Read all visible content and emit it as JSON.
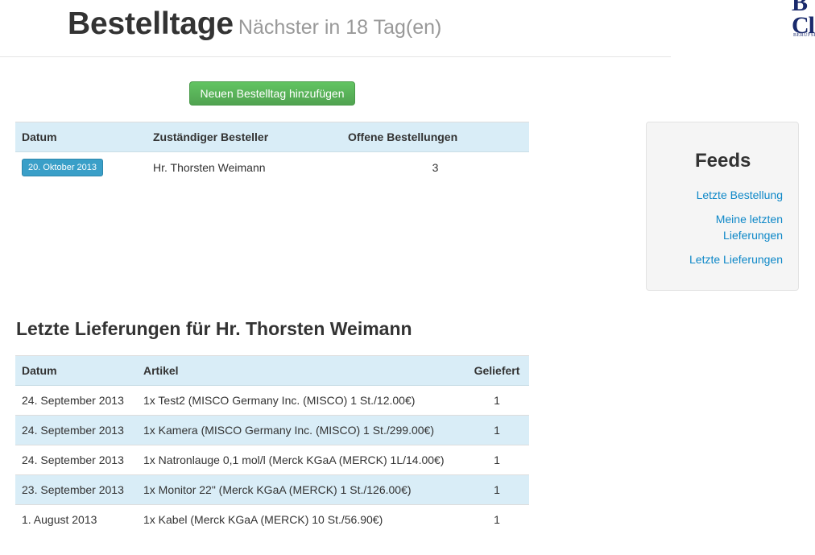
{
  "header": {
    "title": "Bestelltage",
    "subtitle": "Nächster in 18 Tag(en)"
  },
  "logo": {
    "big_text": "B\nCl",
    "small_text": "Berufsf"
  },
  "actions": {
    "add_order_day": "Neuen Bestelltag hinzufügen"
  },
  "order_days": {
    "columns": [
      "Datum",
      "Zuständiger Besteller",
      "Offene Bestellungen"
    ],
    "rows": [
      {
        "date": "20. Oktober 2013",
        "buyer": "Hr. Thorsten Weimann",
        "open_orders": "3"
      }
    ]
  },
  "feeds": {
    "title": "Feeds",
    "links": [
      "Letzte Bestellung",
      "Meine letzten Lieferungen",
      "Letzte Lieferungen"
    ]
  },
  "deliveries": {
    "title": "Letzte Lieferungen für Hr. Thorsten Weimann",
    "columns": [
      "Datum",
      "Artikel",
      "Geliefert"
    ],
    "rows": [
      {
        "date": "24. September 2013",
        "article": "1x Test2 (MISCO Germany Inc. (MISCO) 1 St./12.00€)",
        "delivered": "1"
      },
      {
        "date": "24. September 2013",
        "article": "1x Kamera (MISCO Germany Inc. (MISCO) 1 St./299.00€)",
        "delivered": "1"
      },
      {
        "date": "24. September 2013",
        "article": "1x Natronlauge 0,1 mol/l (Merck KGaA (MERCK) 1L/14.00€)",
        "delivered": "1"
      },
      {
        "date": "23. September 2013",
        "article": "1x Monitor 22\" (Merck KGaA (MERCK) 1 St./126.00€)",
        "delivered": "1"
      },
      {
        "date": "1. August 2013",
        "article": "1x Kabel (Merck KGaA (MERCK) 10 St./56.90€)",
        "delivered": "1"
      }
    ]
  }
}
